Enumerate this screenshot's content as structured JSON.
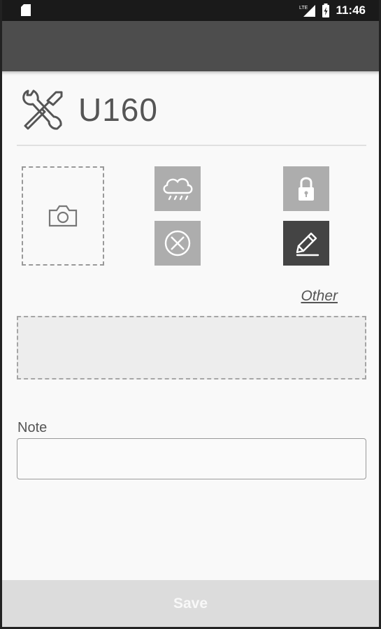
{
  "status_bar": {
    "time": "11:46",
    "network_label": "LTE",
    "icons": [
      "sd-card-icon",
      "lte-signal-icon",
      "battery-charging-icon"
    ]
  },
  "header": {
    "title": "U160",
    "icon": "tools-icon"
  },
  "actions": {
    "photo_icon": "camera-icon",
    "tiles": [
      {
        "name": "weather-icon",
        "color": "#adadad"
      },
      {
        "name": "lock-icon",
        "color": "#adadad"
      },
      {
        "name": "cancel-icon",
        "color": "#adadad"
      },
      {
        "name": "edit-icon",
        "color": "#444444"
      }
    ],
    "other_label": "Other"
  },
  "note": {
    "label": "Note",
    "value": "",
    "placeholder": ""
  },
  "footer": {
    "save_label": "Save"
  },
  "colors": {
    "app_bar": "#4d4d4d",
    "status_bar": "#1a1a1a",
    "save_bar": "#dcdcdc"
  }
}
